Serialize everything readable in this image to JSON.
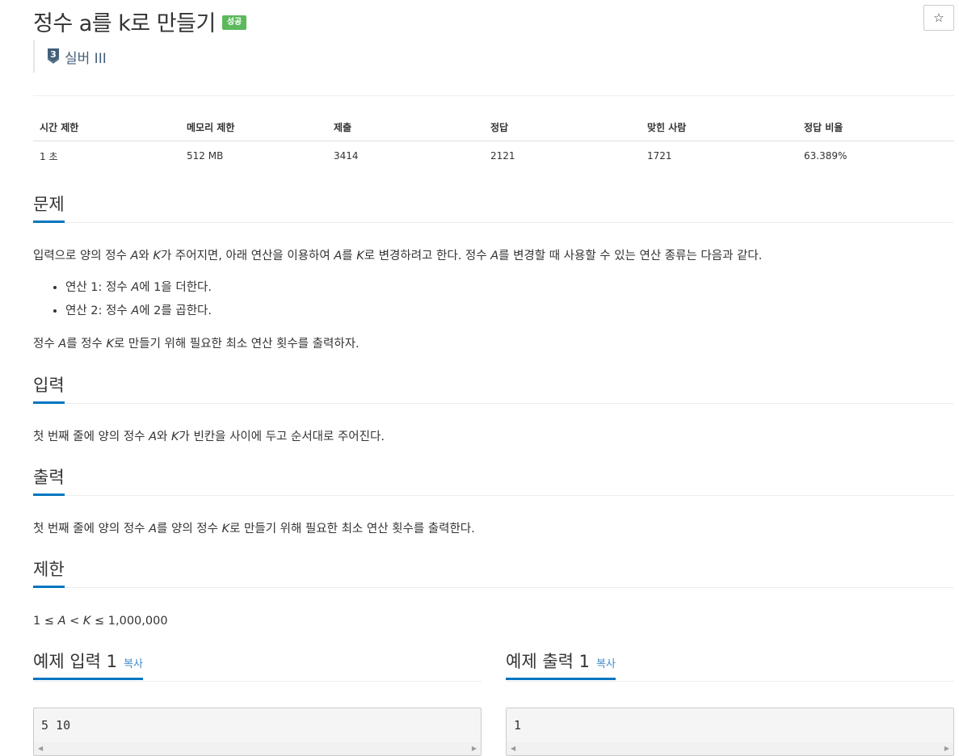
{
  "problem": {
    "title": "정수 a를 k로 만들기",
    "status_badge": "성공",
    "star_symbol": "☆",
    "tier_level": "3",
    "tier_label": "실버 III"
  },
  "stats": {
    "headers": [
      "시간 제한",
      "메모리 제한",
      "제출",
      "정답",
      "맞힌 사람",
      "정답 비율"
    ],
    "values": [
      "1 초",
      "512 MB",
      "3414",
      "2121",
      "1721",
      "63.389%"
    ]
  },
  "sections": {
    "problem_heading": "문제",
    "problem_intro_a": "입력으로 양의 정수 ",
    "problem_intro_b": "와 ",
    "problem_intro_c": "가 주어지면, 아래 연산을 이용하여 ",
    "problem_intro_d": "를 ",
    "problem_intro_e": "로 변경하려고 한다. 정수 ",
    "problem_intro_f": "를 변경할 때 사용할 수 있는 연산 종류는 다음과 같다.",
    "op1_a": "연산 1: 정수 ",
    "op1_b": "에 1을 더한다.",
    "op2_a": "연산 2: 정수 ",
    "op2_b": "에 2를 곱한다.",
    "problem_out_a": "정수 ",
    "problem_out_b": "를 정수 ",
    "problem_out_c": "로 만들기 위해 필요한 최소 연산 횟수를 출력하자.",
    "input_heading": "입력",
    "input_a": "첫 번째 줄에 양의 정수 ",
    "input_b": "와 ",
    "input_c": "가 빈칸을 사이에 두고 순서대로 주어진다.",
    "output_heading": "출력",
    "output_a": "첫 번째 줄에 양의 정수 ",
    "output_b": "를 양의 정수 ",
    "output_c": "로 만들기 위해 필요한 최소 연산 횟수를 출력한다.",
    "limit_heading": "제한",
    "limit_a": "1 ≤ ",
    "limit_b": " < ",
    "limit_c": " ≤ 1,000,000",
    "var_a": "A",
    "var_k": "K"
  },
  "samples": {
    "input_heading": "예제 입력 1",
    "output_heading": "예제 출력 1",
    "copy_label": "복사",
    "input_value": "5 10",
    "output_value": "1"
  },
  "colors": {
    "accent": "#0076c0",
    "badge": "#5cb85c",
    "tier": "#435f7a",
    "link": "#428bca"
  }
}
